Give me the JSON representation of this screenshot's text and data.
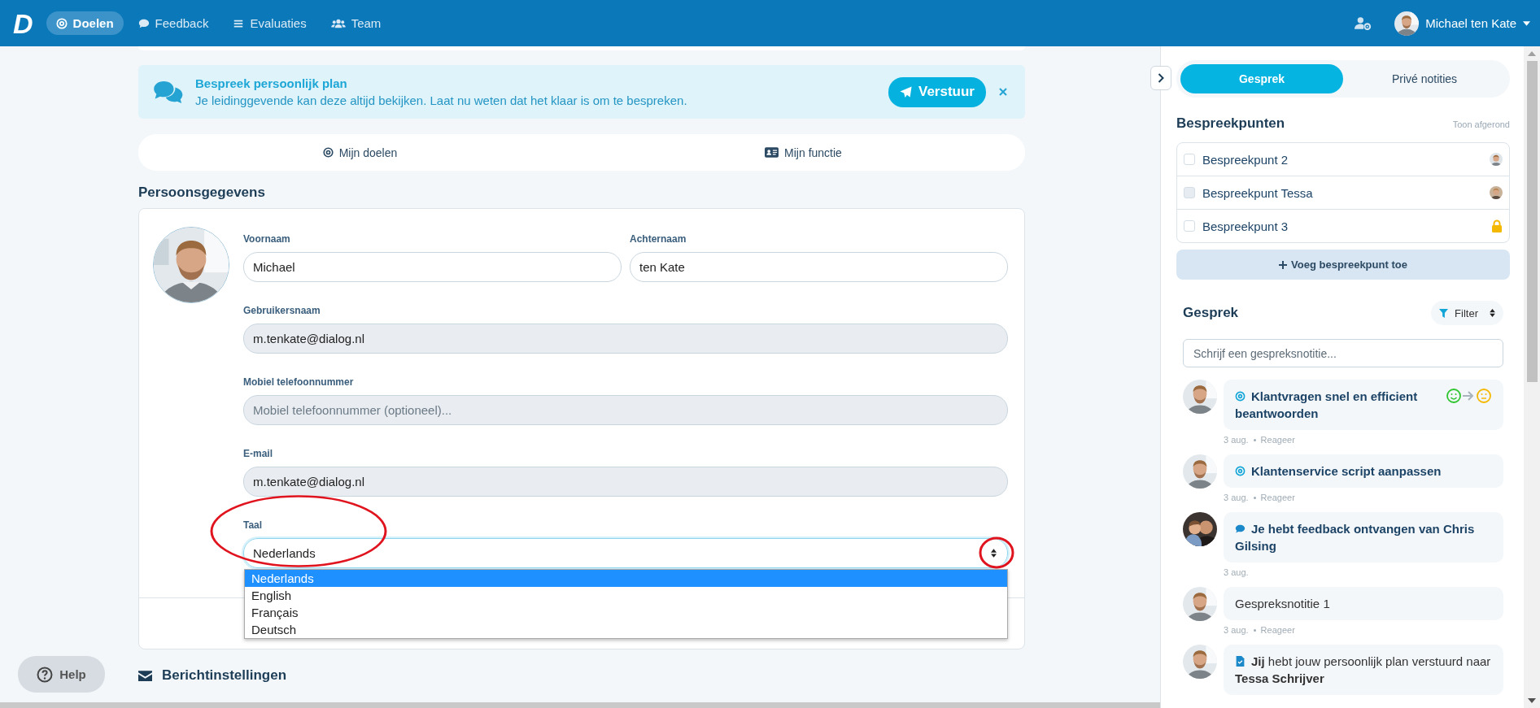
{
  "nav": {
    "logo": "D",
    "items": [
      {
        "label": "Doelen",
        "selected": true
      },
      {
        "label": "Feedback",
        "selected": false
      },
      {
        "label": "Evaluaties",
        "selected": false
      },
      {
        "label": "Team",
        "selected": false
      }
    ],
    "user": "Michael ten Kate"
  },
  "banner": {
    "title": "Bespreek persoonlijk plan",
    "text": "Je leidinggevende kan deze altijd bekijken. Laat nu weten dat het klaar is om te bespreken.",
    "button": "Verstuur"
  },
  "section_tabs": [
    {
      "label": "Mijn doelen"
    },
    {
      "label": "Mijn functie"
    }
  ],
  "profile": {
    "heading": "Persoonsgegevens",
    "name_fields": [
      {
        "label": "Voornaam",
        "value": "Michael",
        "disabled": false
      },
      {
        "label": "Achternaam",
        "value": "ten Kate",
        "disabled": false
      }
    ],
    "fields": [
      {
        "label": "Gebruikersnaam",
        "value": "m.tenkate@dialog.nl",
        "disabled": true
      },
      {
        "label": "Mobiel telefoonnummer",
        "placeholder": "Mobiel telefoonnummer (optioneel)...",
        "disabled": true
      },
      {
        "label": "E-mail",
        "value": "m.tenkate@dialog.nl",
        "disabled": true
      }
    ],
    "language": {
      "label": "Taal",
      "value": "Nederlands",
      "circled": true,
      "options": [
        {
          "label": "Nederlands",
          "selected": true
        },
        {
          "label": "English",
          "selected": false
        },
        {
          "label": "Français",
          "selected": false
        },
        {
          "label": "Deutsch",
          "selected": false
        }
      ]
    }
  },
  "help": "Help",
  "message_settings": {
    "heading": "Berichtinstellingen"
  },
  "panel": {
    "tabs": [
      {
        "label": "Gesprek",
        "selected": true
      },
      {
        "label": "Privé notities",
        "selected": false
      }
    ],
    "points": {
      "heading": "Bespreekpunten",
      "show_done": "Toon afgerond",
      "add": "Voeg bespreekpunt toe",
      "items": [
        {
          "label": "Bespreekpunt 2",
          "checked": false,
          "disabled": false
        },
        {
          "label": "Bespreekpunt Tessa",
          "checked": false,
          "disabled": true
        },
        {
          "label": "Bespreekpunt 3",
          "checked": false,
          "disabled": false,
          "kind": "lock"
        }
      ]
    },
    "conversation": {
      "heading": "Gesprek",
      "filter": "Filter",
      "placeholder": "Schrijf een gespreksnotitie...",
      "items": [
        {
          "kind": "goal",
          "text": "**Klantvragen snel en efficient beantwoorden**",
          "mood_change": true,
          "date": "3 aug.",
          "reply": "Reageer"
        },
        {
          "kind": "goal",
          "text": "**Klantenservice script aanpassen**",
          "mood_change": false,
          "date": "3 aug.",
          "reply": "Reageer"
        },
        {
          "kind": "feedback",
          "text": "**Je hebt feedback ontvangen van Chris Gilsing**",
          "mood_change": false,
          "date": "3 aug."
        },
        {
          "kind": "note",
          "text": "Gespreksnotitie 1",
          "mood_change": false,
          "date": "3 aug.",
          "reply": "Reageer"
        },
        {
          "kind": "plan",
          "text": "**Jij** hebt jouw persoonlijk plan verstuurd naar **Tessa Schrijver**",
          "mood_change": false
        }
      ]
    }
  }
}
